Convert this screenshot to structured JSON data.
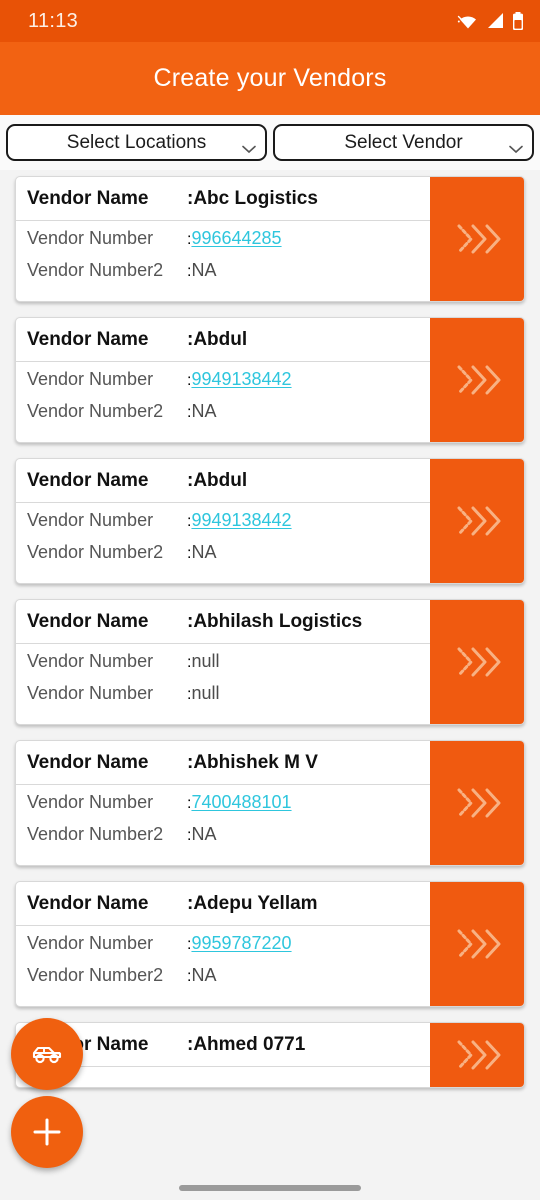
{
  "status_bar": {
    "time": "11:13",
    "icons": [
      "wifi-icon",
      "cellular-signal-icon",
      "battery-icon"
    ]
  },
  "app_bar": {
    "title": "Create your Vendors"
  },
  "filters": [
    {
      "label": "Select Locations",
      "icon": "chevron-down-icon"
    },
    {
      "label": "Select Vendor",
      "icon": "chevron-down-icon"
    }
  ],
  "labels": {
    "vendor_name": "Vendor Name",
    "vendor_number": "Vendor Number",
    "vendor_number2": "Vendor Number2"
  },
  "cards": [
    {
      "name_label": "Vendor Name",
      "name_value": ":Abc Logistics",
      "rows": [
        {
          "label": "Vendor Number",
          "value": "996644285",
          "is_link": true
        },
        {
          "label": "Vendor Number2",
          "value": "NA",
          "is_link": false
        }
      ],
      "action_icon": "double-chevron-right-icon"
    },
    {
      "name_label": "Vendor Name",
      "name_value": ":Abdul",
      "rows": [
        {
          "label": "Vendor Number",
          "value": "9949138442",
          "is_link": true
        },
        {
          "label": "Vendor Number2",
          "value": "NA",
          "is_link": false
        }
      ],
      "action_icon": "double-chevron-right-icon"
    },
    {
      "name_label": "Vendor Name",
      "name_value": ":Abdul",
      "rows": [
        {
          "label": "Vendor Number",
          "value": "9949138442",
          "is_link": true
        },
        {
          "label": "Vendor Number2",
          "value": "NA",
          "is_link": false
        }
      ],
      "action_icon": "double-chevron-right-icon"
    },
    {
      "name_label": "Vendor Name",
      "name_value": ":Abhilash Logistics",
      "rows": [
        {
          "label": "Vendor Number",
          "value": "null",
          "is_link": false
        },
        {
          "label": "Vendor Number",
          "value": "null",
          "is_link": false
        }
      ],
      "action_icon": "double-chevron-right-icon"
    },
    {
      "name_label": "Vendor Name",
      "name_value": ":Abhishek M V",
      "rows": [
        {
          "label": "Vendor Number",
          "value": "7400488101",
          "is_link": true
        },
        {
          "label": "Vendor Number2",
          "value": "NA",
          "is_link": false
        }
      ],
      "action_icon": "double-chevron-right-icon"
    },
    {
      "name_label": "Vendor Name",
      "name_value": ":Adepu Yellam",
      "rows": [
        {
          "label": "Vendor Number",
          "value": "9959787220",
          "is_link": true
        },
        {
          "label": "Vendor Number2",
          "value": "NA",
          "is_link": false
        }
      ],
      "action_icon": "double-chevron-right-icon"
    },
    {
      "name_label": "Vendor Name",
      "name_value": ":Ahmed 0771",
      "rows": [],
      "action_icon": "double-chevron-right-icon"
    }
  ],
  "fabs": [
    {
      "name": "vehicle-fab",
      "icon": "car-icon"
    },
    {
      "name": "add-fab",
      "icon": "plus-icon"
    }
  ],
  "colors": {
    "status_bar": "#e85206",
    "app_bar": "#f26212",
    "accent": "#f05a10",
    "link": "#2ec6dd",
    "page_bg": "#f3f3f3"
  }
}
